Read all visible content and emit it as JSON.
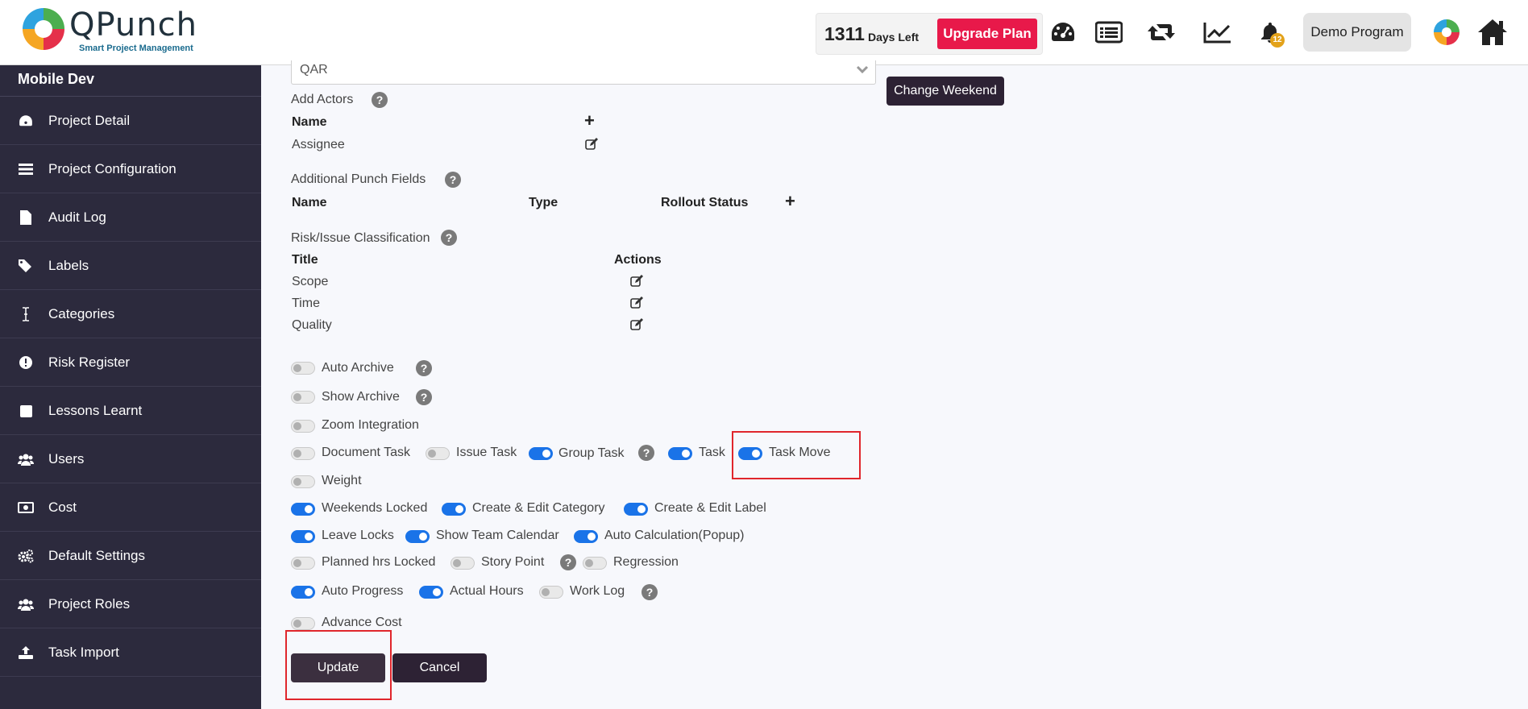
{
  "header": {
    "logo_text": "QPunch",
    "logo_tagline": "Smart Project Management",
    "days_left_number": "1311",
    "days_left_label": "Days Left",
    "upgrade_label": "Upgrade Plan",
    "notification_count": "12",
    "program_label": "Demo Program",
    "icons": [
      "dashboard-icon",
      "list-icon",
      "retweet-icon",
      "chart-line-icon",
      "bell-icon",
      "app-logo-icon",
      "home-icon"
    ]
  },
  "sidebar": {
    "title": "Mobile Dev",
    "items": [
      {
        "label": "Project Detail",
        "icon": "dashboard-icon"
      },
      {
        "label": "Project Configuration",
        "icon": "list-icon"
      },
      {
        "label": "Audit Log",
        "icon": "file-icon"
      },
      {
        "label": "Labels",
        "icon": "tags-icon"
      },
      {
        "label": "Categories",
        "icon": "i-cursor-icon"
      },
      {
        "label": "Risk Register",
        "icon": "exclamation-circle-icon"
      },
      {
        "label": "Lessons Learnt",
        "icon": "square-icon"
      },
      {
        "label": "Users",
        "icon": "users-icon"
      },
      {
        "label": "Cost",
        "icon": "money-icon"
      },
      {
        "label": "Default Settings",
        "icon": "cogs-icon"
      },
      {
        "label": "Project Roles",
        "icon": "users-icon"
      },
      {
        "label": "Task Import",
        "icon": "upload-icon"
      }
    ]
  },
  "form": {
    "select_value": "QAR",
    "change_weekend_label": "Change Weekend",
    "actors": {
      "title": "Add Actors",
      "header_name": "Name",
      "rows": [
        "Assignee"
      ]
    },
    "punch_fields": {
      "title": "Additional Punch Fields",
      "headers": [
        "Name",
        "Type",
        "Rollout Status"
      ]
    },
    "risk": {
      "title": "Risk/Issue Classification",
      "header_title": "Title",
      "header_actions": "Actions",
      "rows": [
        "Scope",
        "Time",
        "Quality"
      ]
    },
    "toggles": {
      "auto_archive": {
        "label": "Auto Archive",
        "on": false
      },
      "show_archive": {
        "label": "Show Archive",
        "on": false
      },
      "zoom_integration": {
        "label": "Zoom Integration",
        "on": false
      },
      "document_task": {
        "label": "Document Task",
        "on": false
      },
      "issue_task": {
        "label": "Issue Task",
        "on": false
      },
      "group_task": {
        "label": "Group Task",
        "on": true
      },
      "task": {
        "label": "Task",
        "on": true
      },
      "task_move": {
        "label": "Task Move",
        "on": true
      },
      "weight": {
        "label": "Weight",
        "on": false
      },
      "weekends_locked": {
        "label": "Weekends Locked",
        "on": true
      },
      "create_edit_category": {
        "label": "Create & Edit Category",
        "on": true
      },
      "create_edit_label": {
        "label": "Create & Edit Label",
        "on": true
      },
      "leave_locks": {
        "label": "Leave Locks",
        "on": true
      },
      "show_team_calendar": {
        "label": "Show Team Calendar",
        "on": true
      },
      "auto_calculation": {
        "label": "Auto Calculation(Popup)",
        "on": true
      },
      "planned_hrs_locked": {
        "label": "Planned hrs Locked",
        "on": false
      },
      "story_point": {
        "label": "Story Point",
        "on": false
      },
      "regression": {
        "label": "Regression",
        "on": false
      },
      "auto_progress": {
        "label": "Auto Progress",
        "on": true
      },
      "actual_hours": {
        "label": "Actual Hours",
        "on": true
      },
      "work_log": {
        "label": "Work Log",
        "on": false
      },
      "advance_cost": {
        "label": "Advance Cost",
        "on": false
      }
    },
    "update_label": "Update",
    "cancel_label": "Cancel",
    "help_glyph": "?"
  }
}
